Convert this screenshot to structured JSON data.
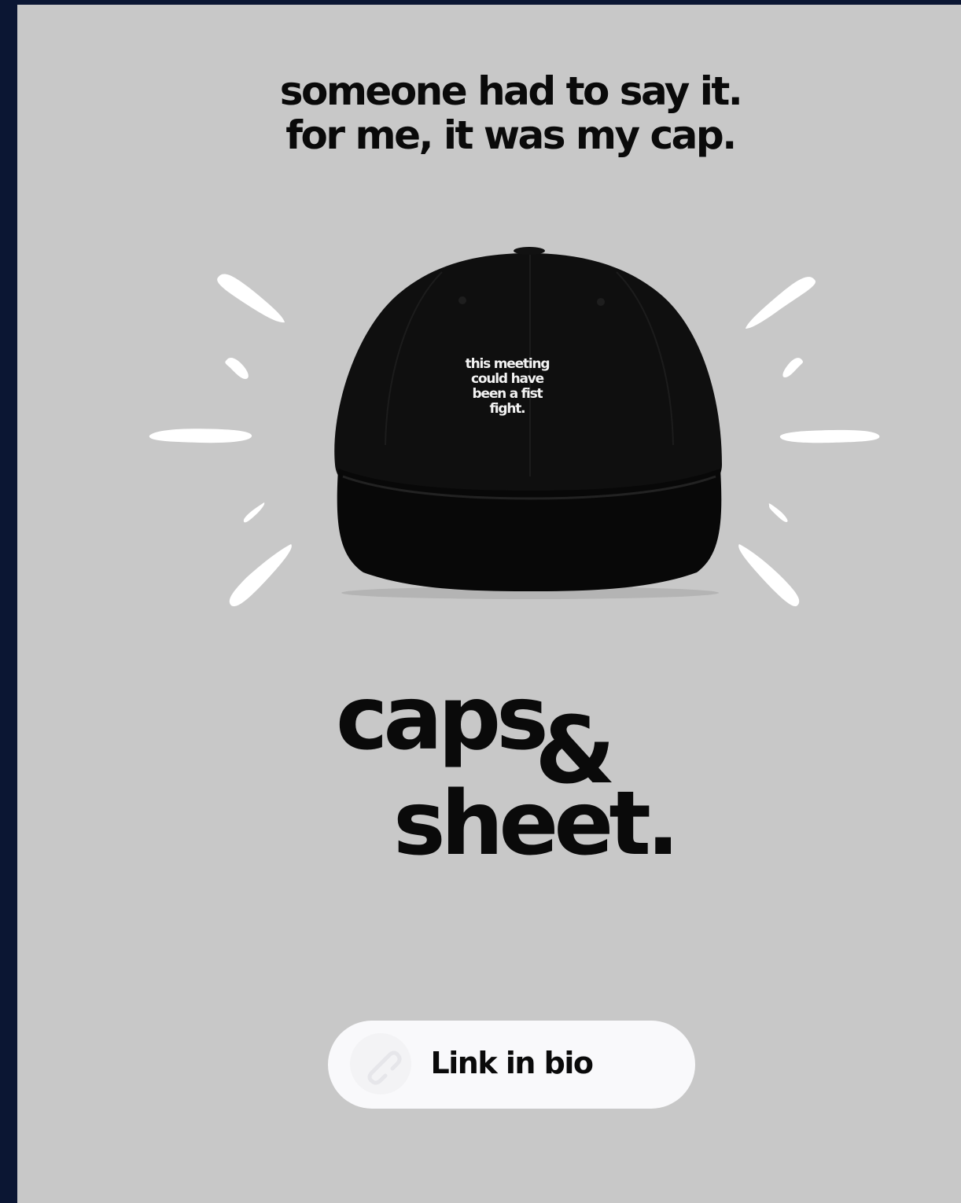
{
  "headline": {
    "line1": "someone had to say it.",
    "line2": "for me, it was my cap."
  },
  "product": {
    "cap_text": [
      "this meeting",
      "could have",
      "been a fist",
      "fight."
    ]
  },
  "brand": {
    "word1": "caps",
    "ampersand": "&",
    "word2": "sheet."
  },
  "cta": {
    "label": "Link in bio",
    "icon": "link-icon"
  },
  "colors": {
    "background": "#c8c8c8",
    "frame": "#0b1633",
    "text": "#0a0a0a",
    "button": "#f9f9fb"
  }
}
